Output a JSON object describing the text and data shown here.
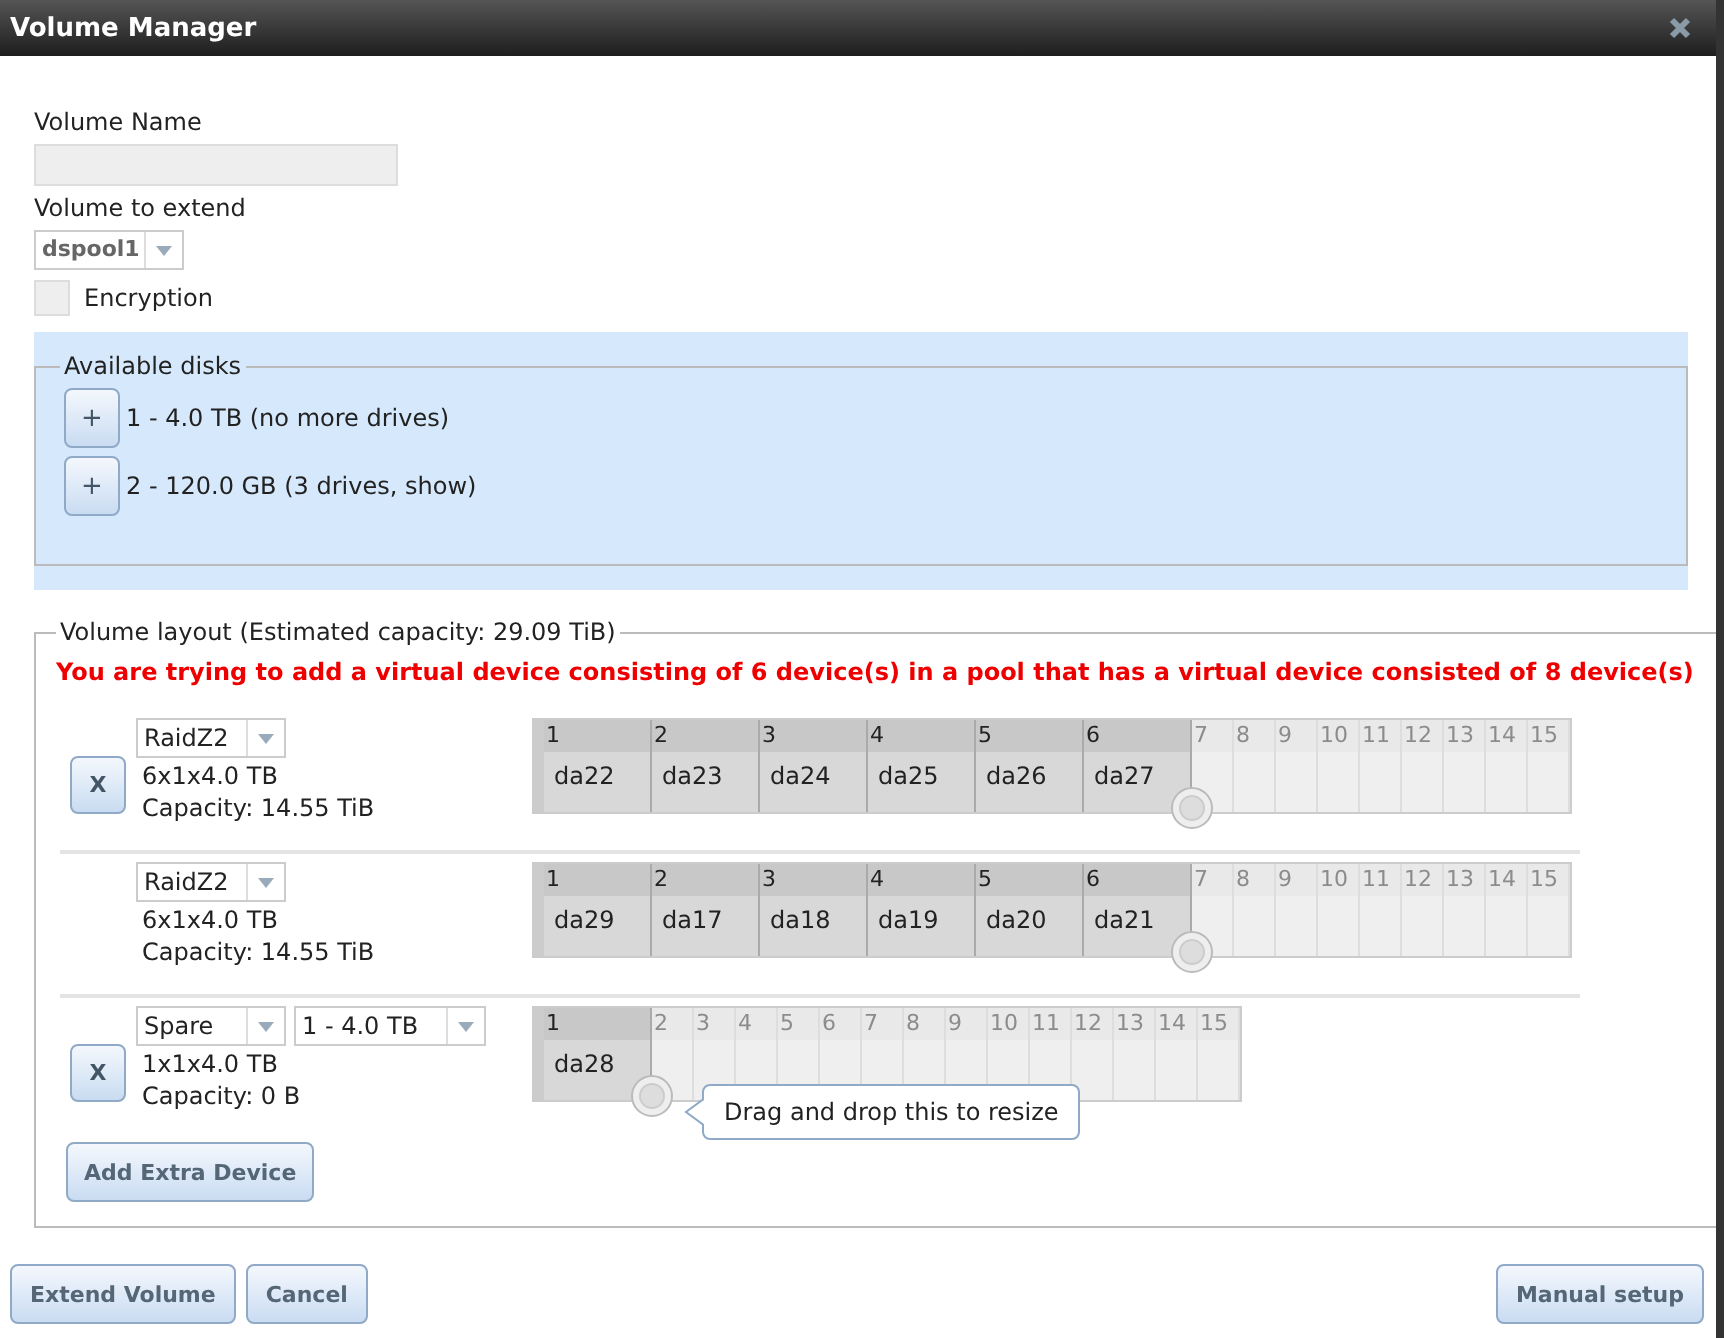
{
  "window": {
    "title": "Volume Manager"
  },
  "volume_name": {
    "label": "Volume Name"
  },
  "volume_to_extend": {
    "label": "Volume to extend",
    "value": "dspool1"
  },
  "encryption": {
    "label": "Encryption",
    "checked": false
  },
  "available_disks": {
    "title": "Available disks",
    "groups": [
      "1 - 4.0 TB (no more drives)",
      "2 - 120.0 GB (3 drives, show)"
    ],
    "add_label": "+"
  },
  "layout": {
    "title": "Volume layout (Estimated capacity: 29.09 TiB)",
    "warning": "You are trying to add a virtual device consisting of 6 device(s) in a pool that has a virtual device consisted of 8 device(s)",
    "vdevs": [
      {
        "remove": "X",
        "type": "RaidZ2",
        "summary": "6x1x4.0 TB",
        "capacity": "Capacity: 14.55 TiB",
        "slots": [
          "1",
          "2",
          "3",
          "4",
          "5",
          "6",
          "7",
          "8",
          "9",
          "10",
          "11",
          "12",
          "13",
          "14",
          "15"
        ],
        "disks": [
          "da22",
          "da23",
          "da24",
          "da25",
          "da26",
          "da27"
        ]
      },
      {
        "type": "RaidZ2",
        "summary": "6x1x4.0 TB",
        "capacity": "Capacity: 14.55 TiB",
        "slots": [
          "1",
          "2",
          "3",
          "4",
          "5",
          "6",
          "7",
          "8",
          "9",
          "10",
          "11",
          "12",
          "13",
          "14",
          "15"
        ],
        "disks": [
          "da29",
          "da17",
          "da18",
          "da19",
          "da20",
          "da21"
        ]
      },
      {
        "remove": "X",
        "type": "Spare",
        "size": "1 - 4.0 TB",
        "summary": "1x1x4.0 TB",
        "capacity": "Capacity: 0 B",
        "slots": [
          "1",
          "2",
          "3",
          "4",
          "5",
          "6",
          "7",
          "8",
          "9",
          "10",
          "11",
          "12",
          "13",
          "14",
          "15"
        ],
        "disks": [
          "da28"
        ],
        "tooltip": "Drag and drop this to resize"
      }
    ],
    "add_button": "Add Extra Device"
  },
  "left_buttons": [
    "Extend Volume",
    "Cancel"
  ],
  "right_buttons": [
    "Manual setup"
  ]
}
